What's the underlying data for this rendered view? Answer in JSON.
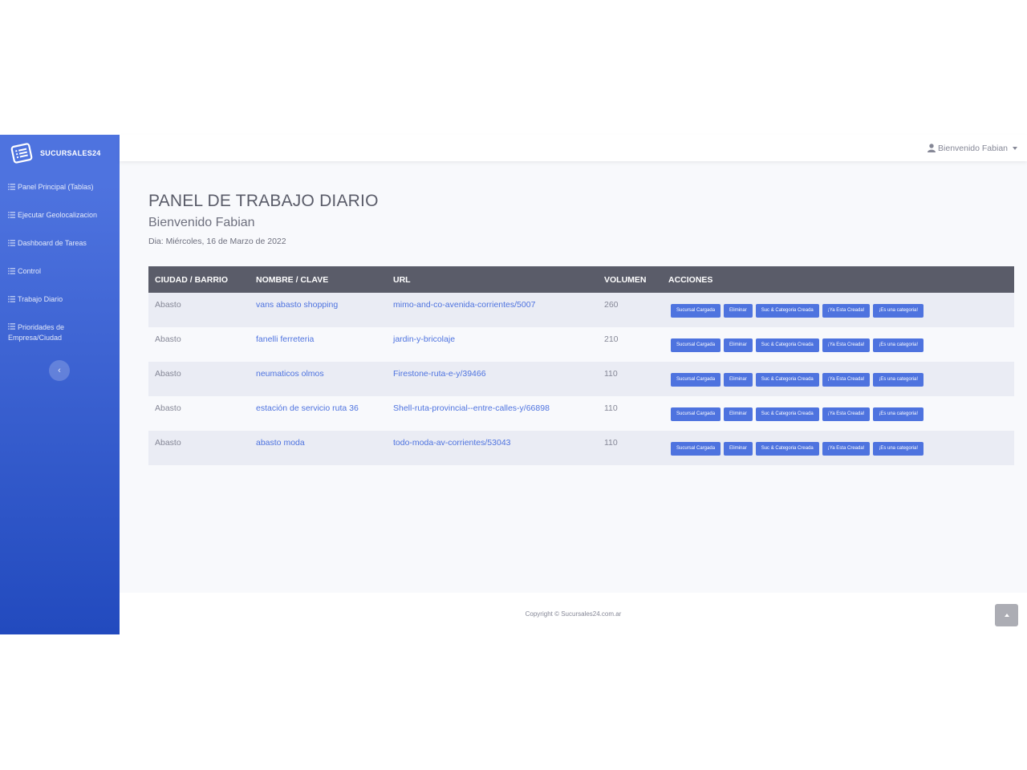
{
  "brand": {
    "name": "SUCURSALES24",
    "icon": "list-alt-icon"
  },
  "sidebar": {
    "items": [
      {
        "label": "Panel Principal (Tablas)",
        "icon": "list-icon"
      },
      {
        "label": "Ejecutar Geolocalizacion",
        "icon": "list-icon"
      },
      {
        "label": "Dashboard de Tareas",
        "icon": "list-icon"
      },
      {
        "label": "Control",
        "icon": "list-icon"
      },
      {
        "label": "Trabajo Diario",
        "icon": "list-icon"
      },
      {
        "label": "Prioridades de Empresa/Ciudad",
        "icon": "list-icon"
      }
    ],
    "toggle_glyph": "‹"
  },
  "topbar": {
    "user_label": "Bienvenido Fabian",
    "user_icon": "user-icon"
  },
  "page": {
    "title": "PANEL DE TRABAJO DIARIO",
    "subtitle": "Bienvenido Fabian",
    "date": "Dia: Miércoles, 16 de Marzo de 2022"
  },
  "table": {
    "headers": [
      "CIUDAD / BARRIO",
      "NOMBRE / CLAVE",
      "URL",
      "VOLUMEN",
      "ACCIONES"
    ],
    "actions": [
      "Sucursal Cargada",
      "Eliminar",
      "Suc & Categoria Creada",
      "¡Ya Esta Creada!",
      "¡Es una categoria!"
    ],
    "rows": [
      {
        "city": "Abasto",
        "name": "vans abasto shopping",
        "url": "mimo-and-co-avenida-corrientes/5007",
        "volume": "260"
      },
      {
        "city": "Abasto",
        "name": "fanelli ferreteria",
        "url": "jardin-y-bricolaje",
        "volume": "210"
      },
      {
        "city": "Abasto",
        "name": "neumaticos olmos",
        "url": "Firestone-ruta-e-y/39466",
        "volume": "110"
      },
      {
        "city": "Abasto",
        "name": "estación de servicio ruta 36",
        "url": "Shell-ruta-provincial--entre-calles-y/66898",
        "volume": "110"
      },
      {
        "city": "Abasto",
        "name": "abasto moda",
        "url": "todo-moda-av-corrientes/53043",
        "volume": "110"
      }
    ]
  },
  "footer": {
    "copyright": "Copyright © Sucursales24.com.ar"
  },
  "colors": {
    "primary": "#4e73df",
    "primary_dark": "#224abe",
    "table_header": "#5a5c69"
  }
}
